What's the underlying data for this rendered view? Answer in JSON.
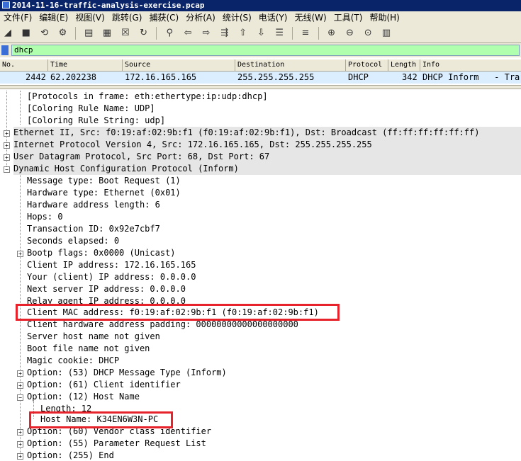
{
  "window": {
    "title": "2014-11-16-traffic-analysis-exercise.pcap"
  },
  "menu": [
    "文件(F)",
    "编辑(E)",
    "视图(V)",
    "跳转(G)",
    "捕获(C)",
    "分析(A)",
    "统计(S)",
    "电话(Y)",
    "无线(W)",
    "工具(T)",
    "帮助(H)"
  ],
  "toolbar_icons": [
    "shark-fin-start-icon",
    "stop-icon",
    "restart-icon",
    "options-gear-icon",
    "open-folder-icon",
    "save-file-icon",
    "close-file-icon",
    "reload-icon",
    "find-packet-icon",
    "go-back-icon",
    "go-forward-icon",
    "go-to-packet-icon",
    "go-first-icon",
    "go-last-icon",
    "auto-scroll-icon",
    "colorize-icon",
    "zoom-in-icon",
    "zoom-out-icon",
    "normal-size-icon",
    "resize-columns-icon"
  ],
  "filter": {
    "value": "dhcp"
  },
  "packet_list": {
    "columns": [
      "No.",
      "Time",
      "Source",
      "Destination",
      "Protocol",
      "Length",
      "Info"
    ],
    "row": {
      "no": "2442",
      "time": "62.202238",
      "source": "172.16.165.165",
      "destination": "255.255.255.255",
      "protocol": "DHCP",
      "length": "342",
      "info": "DHCP Inform   - Tra"
    }
  },
  "tree": [
    "[Protocols in frame: eth:ethertype:ip:udp:dhcp]",
    "[Coloring Rule Name: UDP]",
    "[Coloring Rule String: udp]",
    "Ethernet II, Src: f0:19:af:02:9b:f1 (f0:19:af:02:9b:f1), Dst: Broadcast (ff:ff:ff:ff:ff:ff)",
    "Internet Protocol Version 4, Src: 172.16.165.165, Dst: 255.255.255.255",
    "User Datagram Protocol, Src Port: 68, Dst Port: 67",
    "Dynamic Host Configuration Protocol (Inform)",
    "Message type: Boot Request (1)",
    "Hardware type: Ethernet (0x01)",
    "Hardware address length: 6",
    "Hops: 0",
    "Transaction ID: 0x92e7cbf7",
    "Seconds elapsed: 0",
    "Bootp flags: 0x0000 (Unicast)",
    "Client IP address: 172.16.165.165",
    "Your (client) IP address: 0.0.0.0",
    "Next server IP address: 0.0.0.0",
    "Relay agent IP address: 0.0.0.0",
    "Client MAC address: f0:19:af:02:9b:f1 (f0:19:af:02:9b:f1)",
    "Client hardware address padding: 00000000000000000000",
    "Server host name not given",
    "Boot file name not given",
    "Magic cookie: DHCP",
    "Option: (53) DHCP Message Type (Inform)",
    "Option: (61) Client identifier",
    "Option: (12) Host Name",
    "Length: 12",
    "Host Name: K34EN6W3N-PC",
    "Option: (60) Vendor class identifier",
    "Option: (55) Parameter Request List",
    "Option: (255) End"
  ]
}
